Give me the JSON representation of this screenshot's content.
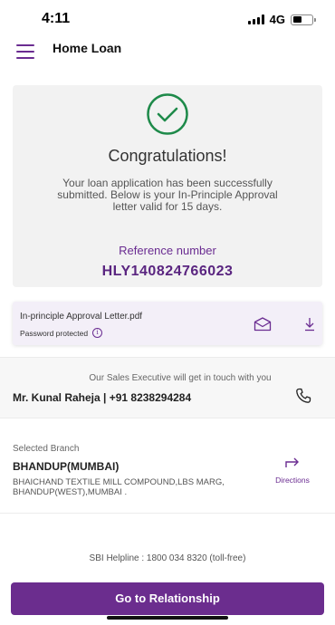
{
  "status_bar": {
    "time": "4:11",
    "network": "4G",
    "battery_level": 0.45
  },
  "app_bar": {
    "title": "Home Loan",
    "menu_icon": "hamburger-menu-icon"
  },
  "success": {
    "icon": "check-circle-icon",
    "title": "Congratulations!",
    "message": "Your loan application has been successfully submitted. Below is your In-Principle Approval letter valid for 15 days.",
    "reference_label": "Reference number",
    "reference_number": "HLY140824766023"
  },
  "letter": {
    "file_name": "In-principle Approval Letter.pdf",
    "note": "Password protected",
    "icons": [
      "info-icon",
      "email-icon",
      "download-icon"
    ]
  },
  "executive": {
    "note": "Our Sales Executive will get in touch with you",
    "contact": "Mr. Kunal Raheja | +91 8238294284",
    "icon": "phone-icon"
  },
  "branch": {
    "label": "Selected Branch",
    "name": "BHANDUP(MUMBAI)",
    "address": "BHAICHAND TEXTILE MILL COMPOUND,LBS MARG, BHANDUP(WEST),MUMBAI .",
    "directions_label": "Directions",
    "icon": "directions-icon"
  },
  "helpline": "SBI Helpline : 1800 034 8320 (toll-free)",
  "cta": {
    "label": "Go to Relationship"
  },
  "colors": {
    "brand_purple": "#6b2d8e",
    "success_green": "#1e8a4a",
    "card_grey": "#f2f2f2",
    "letter_card": "#f3eff8"
  }
}
